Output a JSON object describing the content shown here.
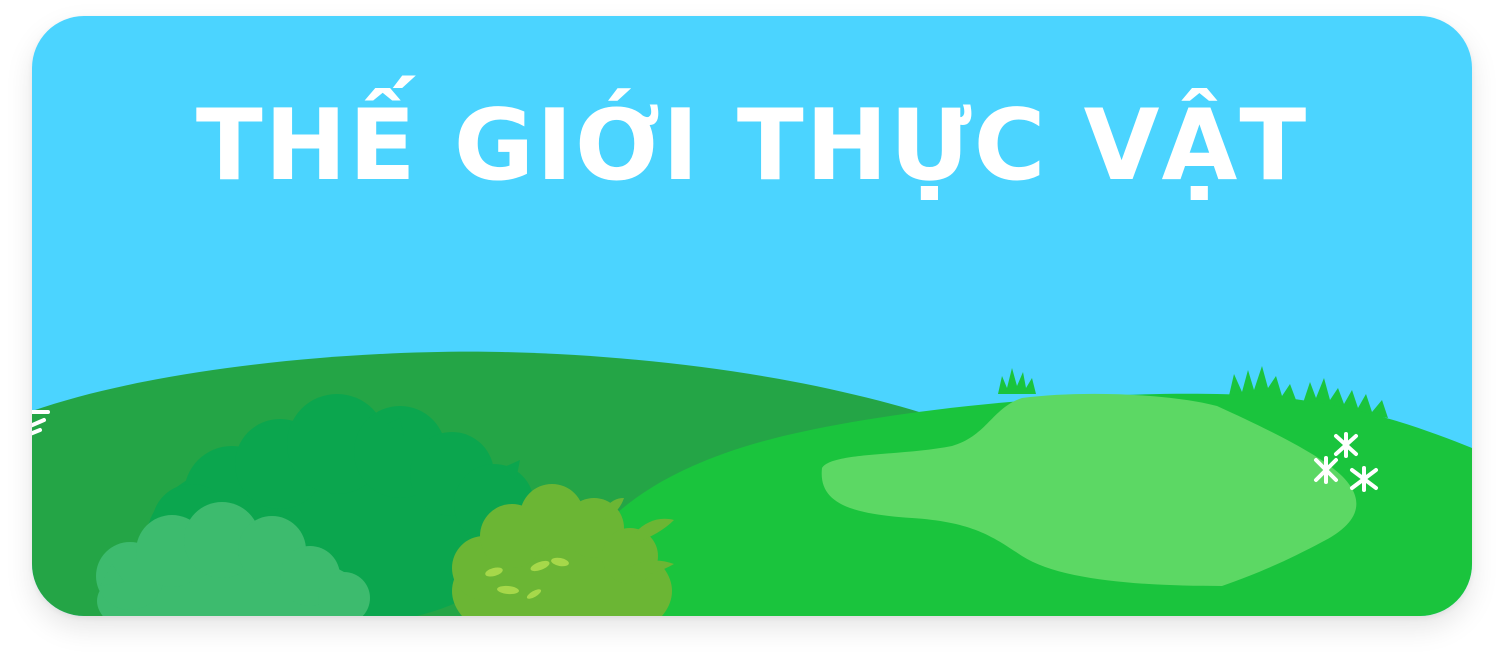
{
  "banner": {
    "title": "THẾ GIỚI THỰC VẬT"
  },
  "colors": {
    "sky": "#4BD4FF",
    "back_hill": "#24A546",
    "front_hill": "#1AC43D",
    "meadow": "#5CD864",
    "bush_dark": "#0BA64E",
    "bush_light": "#3DBB6E",
    "bush_lime": "#6BB634",
    "grass_tuft": "#1AC43D",
    "flowers": "#FFFFFF",
    "title_text": "#FFFFFF"
  },
  "icons": [
    "grass-tuft-icon",
    "flower-icon",
    "bush-icon"
  ]
}
